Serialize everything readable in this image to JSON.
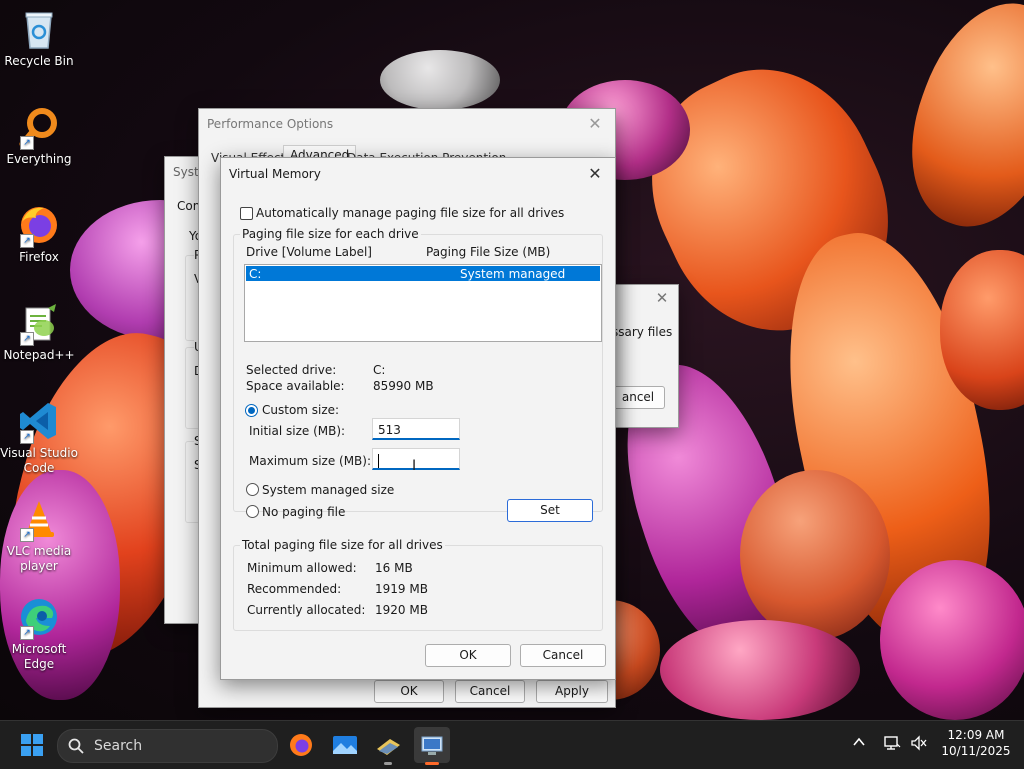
{
  "desktop": {
    "icons": [
      {
        "label": "Recycle Bin",
        "icon": "recycle-bin-icon"
      },
      {
        "label": "Everything",
        "icon": "everything-search-icon"
      },
      {
        "label": "Firefox",
        "icon": "firefox-icon"
      },
      {
        "label": "Notepad++",
        "icon": "notepad-plus-plus-icon"
      },
      {
        "label": "Visual Studio Code",
        "icon": "vscode-icon"
      },
      {
        "label": "VLC media player",
        "icon": "vlc-icon"
      },
      {
        "label": "Microsoft Edge",
        "icon": "edge-icon"
      }
    ]
  },
  "background_windows": {
    "system_props_title_fragment": "Syste",
    "system_props_tab_fragment": "Com",
    "system_props_frag_yo": "Yo",
    "system_props_frag_p": "P",
    "system_props_frag_v": "V",
    "system_props_frag_u": "U",
    "system_props_frag_d": "D",
    "system_props_frag_s": "S",
    "system_props_frag_s2": "S",
    "small_dialog_text": "ssary files",
    "small_dialog_cancel": "ancel"
  },
  "performance_options": {
    "title": "Performance Options",
    "tabs": [
      "Visual Effects",
      "Advanced",
      "Data Execution Prevention"
    ],
    "active_tab": "Advanced",
    "buttons": {
      "ok": "OK",
      "cancel": "Cancel",
      "apply": "Apply"
    }
  },
  "virtual_memory": {
    "title": "Virtual Memory",
    "auto_manage_label": "Automatically manage paging file size for all drives",
    "auto_manage_checked": false,
    "per_drive_group": "Paging file size for each drive",
    "columns": [
      "Drive  [Volume Label]",
      "Paging File Size (MB)"
    ],
    "drives": [
      {
        "drive": "C:",
        "size": "System managed",
        "selected": true
      }
    ],
    "selected_drive_label": "Selected drive:",
    "selected_drive_value": "C:",
    "space_label": "Space available:",
    "space_value": "85990 MB",
    "custom_size_label": "Custom size:",
    "initial_label": "Initial size (MB):",
    "initial_value": "513",
    "max_label": "Maximum size (MB):",
    "max_value": "",
    "system_managed_label": "System managed size",
    "no_paging_label": "No paging file",
    "set_button": "Set",
    "totals_group": "Total paging file size for all drives",
    "min_label": "Minimum allowed:",
    "min_value": "16 MB",
    "rec_label": "Recommended:",
    "rec_value": "1919 MB",
    "alloc_label": "Currently allocated:",
    "alloc_value": "1920 MB",
    "ok": "OK",
    "cancel": "Cancel"
  },
  "taskbar": {
    "search_placeholder": "Search",
    "time": "12:09 AM",
    "date": "10/11/2025"
  },
  "colors": {
    "accent": "#0067c0",
    "selection": "#0078d7",
    "taskbar": "#1f1f1f"
  }
}
